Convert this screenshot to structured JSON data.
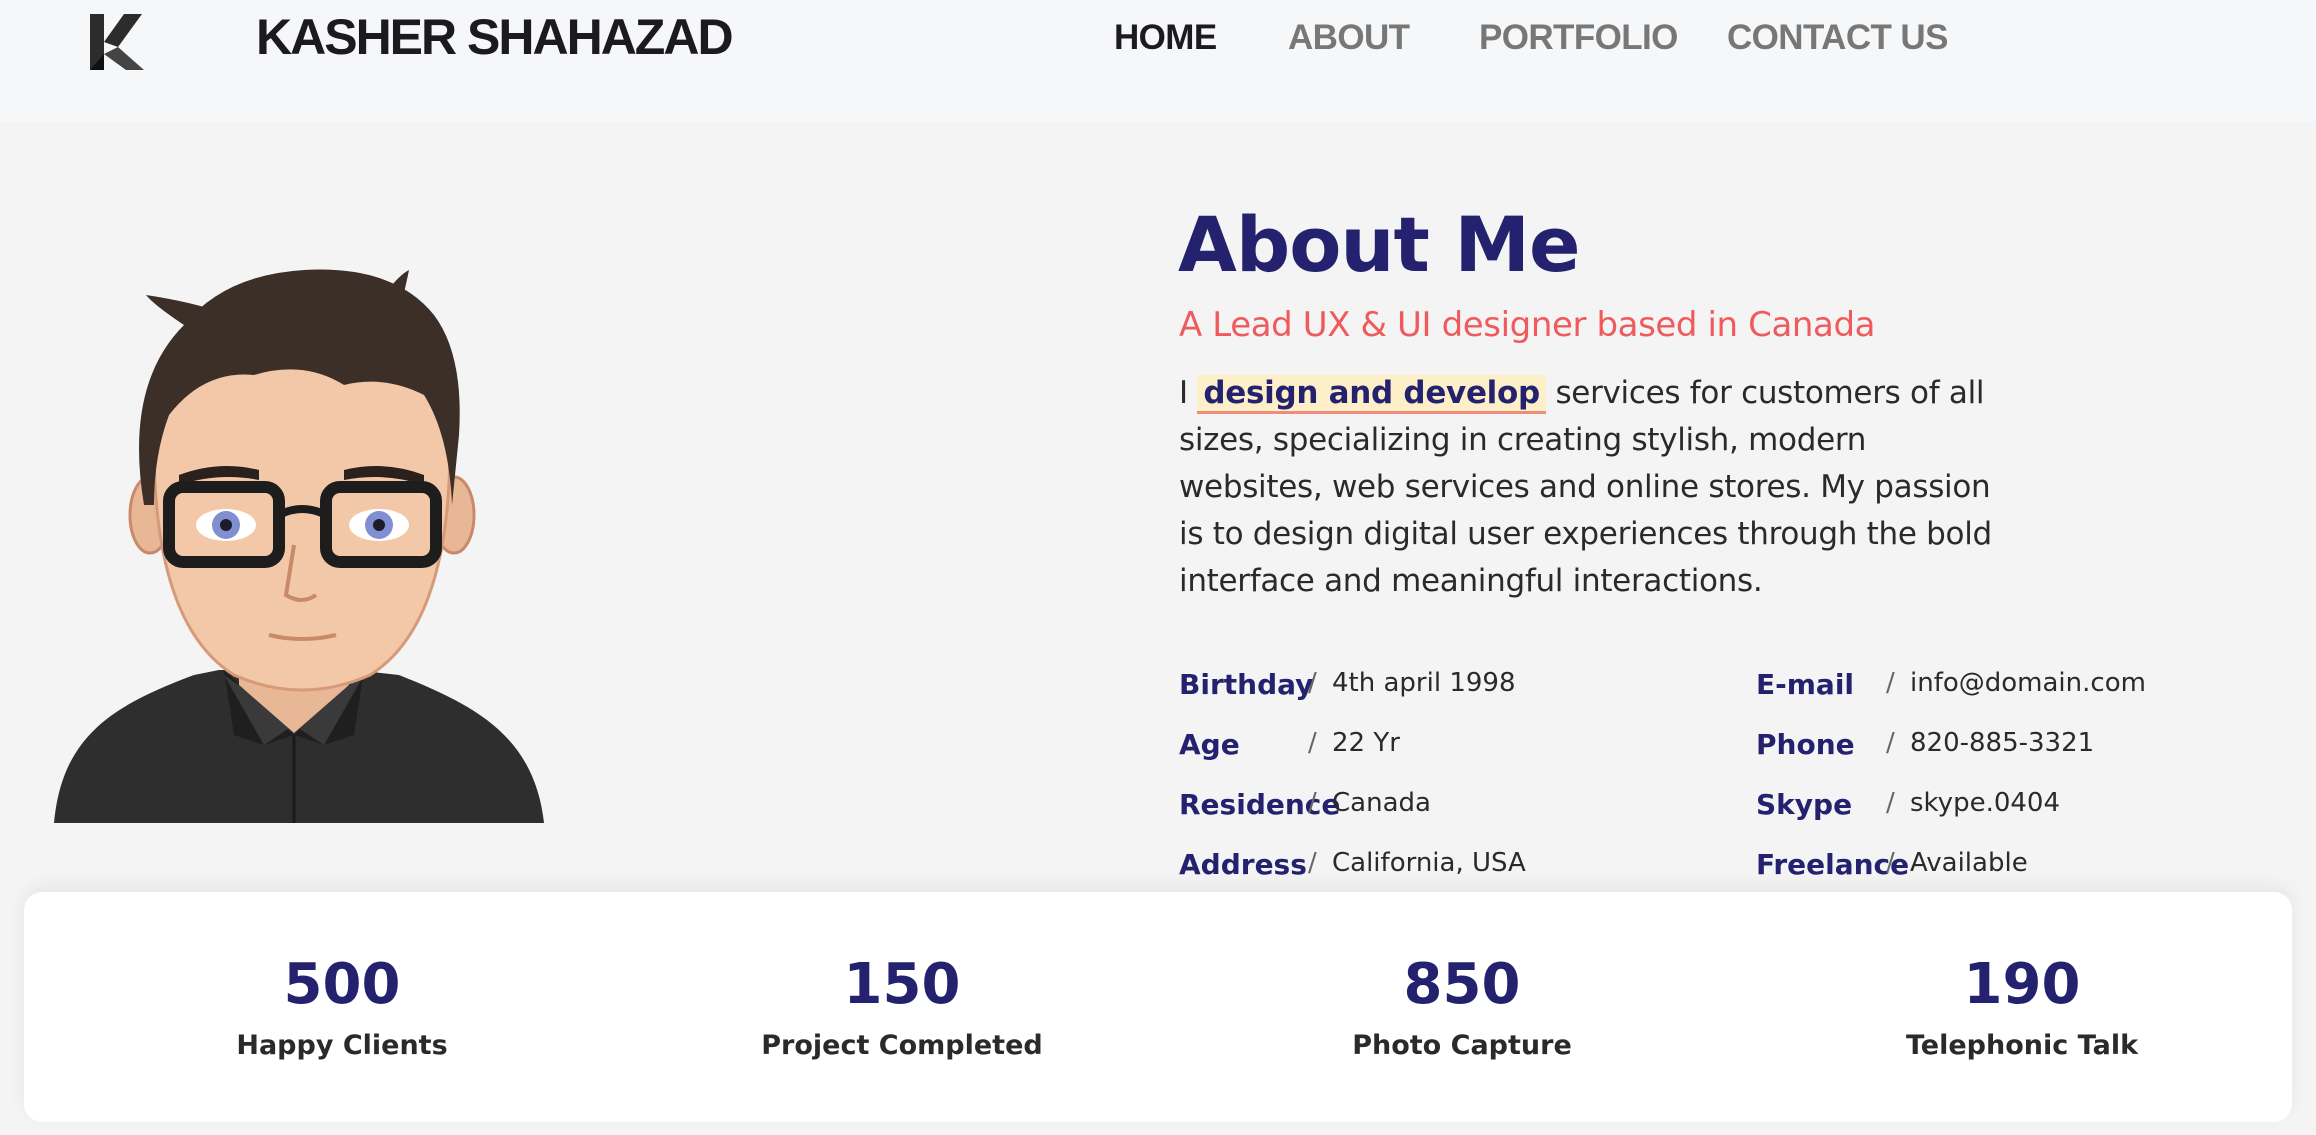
{
  "header": {
    "logo_icon": "k-logo-icon",
    "brand": "KASHER SHAHAZAD",
    "nav": [
      {
        "label": "HOME",
        "active": true
      },
      {
        "label": "ABOUT",
        "active": false
      },
      {
        "label": "PORTFOLIO",
        "active": false
      },
      {
        "label": "CONTACT US",
        "active": false
      }
    ]
  },
  "about": {
    "title": "About Me",
    "subtitle": "A Lead UX & UI designer based in Canada",
    "desc_prefix": "I ",
    "desc_highlight": "design and develop",
    "desc_rest": " services for customers of all sizes, specializing in creating stylish, modern websites, web services and online stores. My passion is to design digital user experiences through the bold interface and meaningful interactions.",
    "info_left": [
      {
        "label": "Birthday",
        "value": "4th april 1998"
      },
      {
        "label": "Age",
        "value": "22 Yr"
      },
      {
        "label": "Residence",
        "value": "Canada"
      },
      {
        "label": "Address",
        "value": "California, USA"
      }
    ],
    "info_right": [
      {
        "label": "E-mail",
        "value": "info@domain.com"
      },
      {
        "label": "Phone",
        "value": "820-885-3321"
      },
      {
        "label": "Skype",
        "value": "skype.0404"
      },
      {
        "label": "Freelance",
        "value": "Available"
      }
    ],
    "separator": "/"
  },
  "stats": [
    {
      "value": "500",
      "label": "Happy Clients"
    },
    {
      "value": "150",
      "label": "Project Completed"
    },
    {
      "value": "850",
      "label": "Photo Capture"
    },
    {
      "value": "190",
      "label": "Telephonic Talk"
    }
  ],
  "colors": {
    "primary": "#24226f",
    "accent": "#ef5a5d",
    "highlight_bg": "#fdf0c8",
    "background": "#f4f4f4"
  }
}
